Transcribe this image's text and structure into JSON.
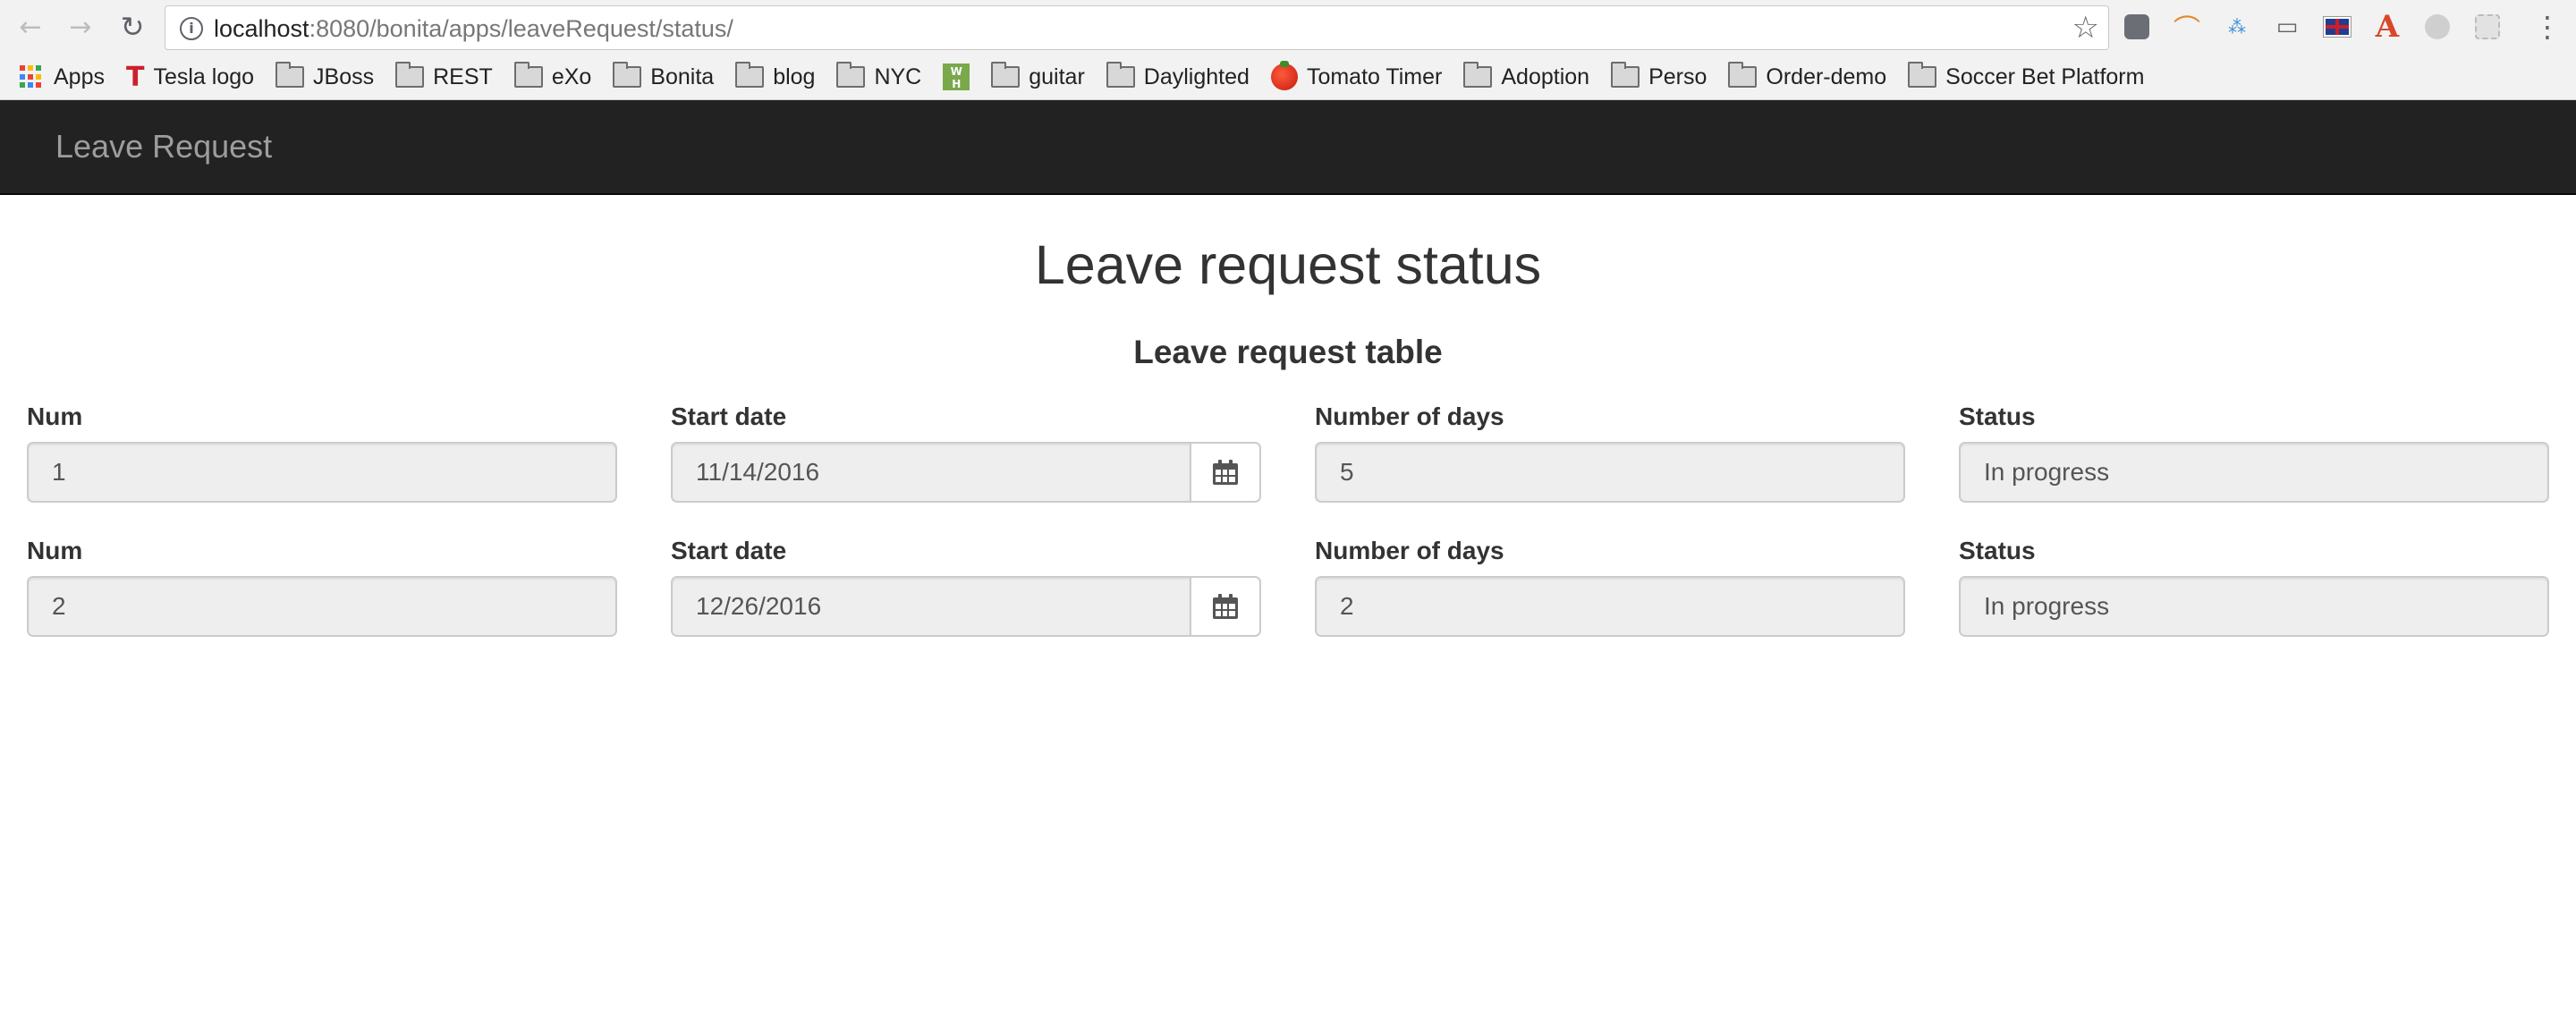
{
  "browser": {
    "url_host": "localhost",
    "url_path": ":8080/bonita/apps/leaveRequest/status/",
    "bookmarks": [
      {
        "label": "Apps",
        "icon": "apps-grid-icon"
      },
      {
        "label": "Tesla logo",
        "icon": "tesla-icon"
      },
      {
        "label": "JBoss",
        "icon": "folder-icon"
      },
      {
        "label": "REST",
        "icon": "folder-icon"
      },
      {
        "label": "eXo",
        "icon": "folder-icon"
      },
      {
        "label": "Bonita",
        "icon": "folder-icon"
      },
      {
        "label": "blog",
        "icon": "folder-icon"
      },
      {
        "label": "NYC",
        "icon": "folder-icon"
      },
      {
        "label": "",
        "icon": "wh-icon"
      },
      {
        "label": "guitar",
        "icon": "folder-icon"
      },
      {
        "label": "Daylighted",
        "icon": "folder-icon"
      },
      {
        "label": "Tomato Timer",
        "icon": "tomato-icon"
      },
      {
        "label": "Adoption",
        "icon": "folder-icon"
      },
      {
        "label": "Perso",
        "icon": "folder-icon"
      },
      {
        "label": "Order-demo",
        "icon": "folder-icon"
      },
      {
        "label": "Soccer Bet Platform",
        "icon": "folder-icon"
      }
    ]
  },
  "app": {
    "brand": "Leave Request"
  },
  "page": {
    "title": "Leave request status",
    "table_title": "Leave request table"
  },
  "rows": [
    {
      "num_label": "Num",
      "num": "1",
      "start_label": "Start date",
      "start": "11/14/2016",
      "days_label": "Number of days",
      "days": "5",
      "status_label": "Status",
      "status": "In progress"
    },
    {
      "num_label": "Num",
      "num": "2",
      "start_label": "Start date",
      "start": "12/26/2016",
      "days_label": "Number of days",
      "days": "2",
      "status_label": "Status",
      "status": "In progress"
    }
  ],
  "colors": {
    "navbar_bg": "#222222",
    "brand_text": "#9d9d9d",
    "input_bg": "#eeeeee",
    "text": "#333333"
  }
}
